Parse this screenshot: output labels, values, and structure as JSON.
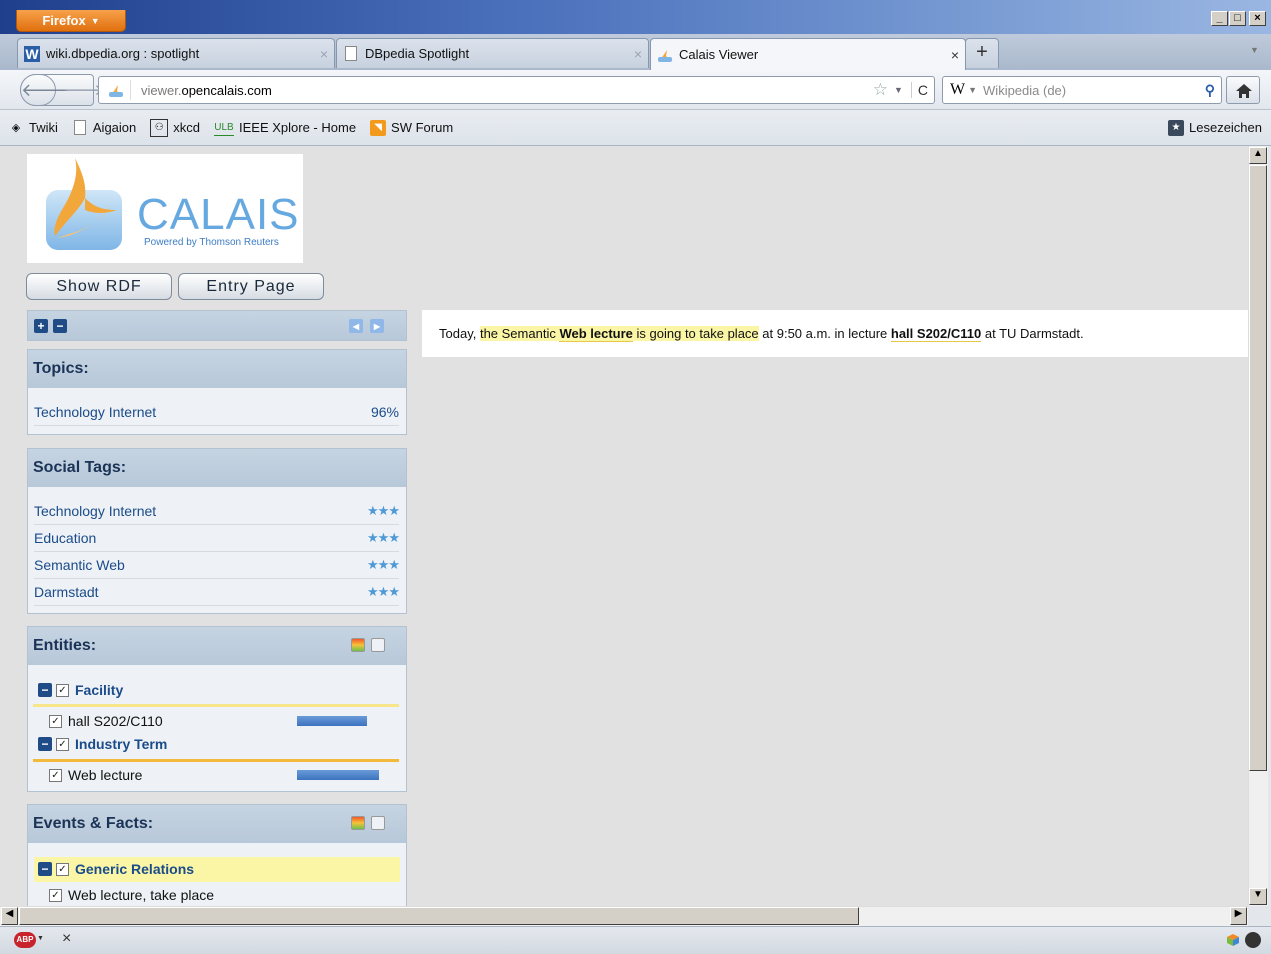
{
  "browser": {
    "menu_button": "Firefox",
    "window_controls": [
      "_",
      "□",
      "×"
    ],
    "tabs": [
      {
        "icon_text": "W",
        "title": "wiki.dbpedia.org : spotlight"
      },
      {
        "title": "DBpedia Spotlight"
      },
      {
        "title": "Calais Viewer"
      }
    ],
    "new_tab": "+",
    "url_sub": "viewer.",
    "url_host": "opencalais.com",
    "search_engine_icon": "W",
    "search_placeholder": "Wikipedia (de)",
    "bookmarks": [
      {
        "label": "Twiki",
        "icon": "twiki-icon"
      },
      {
        "label": "Aigaion",
        "icon": "page-icon"
      },
      {
        "label": "xkcd",
        "icon": "xkcd-icon"
      },
      {
        "icon_text": "ULB",
        "label": "IEEE Xplore - Home",
        "icon": "ulb-icon"
      },
      {
        "label": "SW Forum",
        "icon": "rss-icon"
      }
    ],
    "bookmarks_menu": "Lesezeichen",
    "status_close": "×",
    "adblock_text": "ABP"
  },
  "calais": {
    "logo_text": "CALAIS",
    "logo_sub": "Powered by Thomson Reuters",
    "buttons": {
      "show_rdf": "Show RDF",
      "entry_page": "Entry Page"
    },
    "topics": {
      "title": "Topics:",
      "items": [
        {
          "label": "Technology Internet",
          "value": "96%"
        }
      ]
    },
    "social_tags": {
      "title": "Social Tags:",
      "items": [
        {
          "label": "Technology Internet",
          "stars": "★★★"
        },
        {
          "label": "Education",
          "stars": "★★★"
        },
        {
          "label": "Semantic Web",
          "stars": "★★★"
        },
        {
          "label": "Darmstadt",
          "stars": "★★★"
        }
      ]
    },
    "entities": {
      "title": "Entities:",
      "groups": [
        {
          "name": "Facility",
          "items": [
            {
              "label": "hall S202/C110",
              "relevance": 0.6
            }
          ]
        },
        {
          "name": "Industry Term",
          "items": [
            {
              "label": "Web lecture",
              "relevance": 0.7
            }
          ]
        }
      ]
    },
    "events": {
      "title": "Events & Facts:",
      "groups": [
        {
          "name": "Generic Relations",
          "items": [
            {
              "label": "Web lecture, take place"
            }
          ]
        }
      ]
    },
    "text": {
      "t1": "Today, ",
      "t2": "the Semantic ",
      "t3": "Web lecture",
      "t4": " is going to take place",
      "t5": " at 9:50 a.m. in lecture ",
      "t6": "hall S202/C110",
      "t7": " at TU Darmstadt."
    }
  },
  "colors": {
    "accent": "#1a4c8a",
    "highlight": "#fbf6a6",
    "firefox_orange": "#e0700e"
  }
}
